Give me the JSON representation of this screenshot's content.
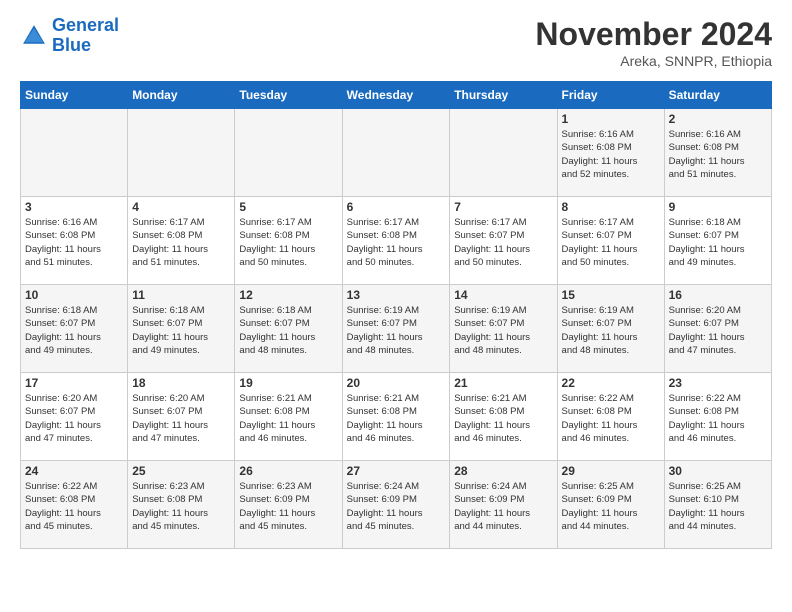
{
  "header": {
    "logo_line1": "General",
    "logo_line2": "Blue",
    "month": "November 2024",
    "location": "Areka, SNNPR, Ethiopia"
  },
  "weekdays": [
    "Sunday",
    "Monday",
    "Tuesday",
    "Wednesday",
    "Thursday",
    "Friday",
    "Saturday"
  ],
  "weeks": [
    [
      {
        "day": "",
        "info": ""
      },
      {
        "day": "",
        "info": ""
      },
      {
        "day": "",
        "info": ""
      },
      {
        "day": "",
        "info": ""
      },
      {
        "day": "",
        "info": ""
      },
      {
        "day": "1",
        "info": "Sunrise: 6:16 AM\nSunset: 6:08 PM\nDaylight: 11 hours\nand 52 minutes."
      },
      {
        "day": "2",
        "info": "Sunrise: 6:16 AM\nSunset: 6:08 PM\nDaylight: 11 hours\nand 51 minutes."
      }
    ],
    [
      {
        "day": "3",
        "info": "Sunrise: 6:16 AM\nSunset: 6:08 PM\nDaylight: 11 hours\nand 51 minutes."
      },
      {
        "day": "4",
        "info": "Sunrise: 6:17 AM\nSunset: 6:08 PM\nDaylight: 11 hours\nand 51 minutes."
      },
      {
        "day": "5",
        "info": "Sunrise: 6:17 AM\nSunset: 6:08 PM\nDaylight: 11 hours\nand 50 minutes."
      },
      {
        "day": "6",
        "info": "Sunrise: 6:17 AM\nSunset: 6:08 PM\nDaylight: 11 hours\nand 50 minutes."
      },
      {
        "day": "7",
        "info": "Sunrise: 6:17 AM\nSunset: 6:07 PM\nDaylight: 11 hours\nand 50 minutes."
      },
      {
        "day": "8",
        "info": "Sunrise: 6:17 AM\nSunset: 6:07 PM\nDaylight: 11 hours\nand 50 minutes."
      },
      {
        "day": "9",
        "info": "Sunrise: 6:18 AM\nSunset: 6:07 PM\nDaylight: 11 hours\nand 49 minutes."
      }
    ],
    [
      {
        "day": "10",
        "info": "Sunrise: 6:18 AM\nSunset: 6:07 PM\nDaylight: 11 hours\nand 49 minutes."
      },
      {
        "day": "11",
        "info": "Sunrise: 6:18 AM\nSunset: 6:07 PM\nDaylight: 11 hours\nand 49 minutes."
      },
      {
        "day": "12",
        "info": "Sunrise: 6:18 AM\nSunset: 6:07 PM\nDaylight: 11 hours\nand 48 minutes."
      },
      {
        "day": "13",
        "info": "Sunrise: 6:19 AM\nSunset: 6:07 PM\nDaylight: 11 hours\nand 48 minutes."
      },
      {
        "day": "14",
        "info": "Sunrise: 6:19 AM\nSunset: 6:07 PM\nDaylight: 11 hours\nand 48 minutes."
      },
      {
        "day": "15",
        "info": "Sunrise: 6:19 AM\nSunset: 6:07 PM\nDaylight: 11 hours\nand 48 minutes."
      },
      {
        "day": "16",
        "info": "Sunrise: 6:20 AM\nSunset: 6:07 PM\nDaylight: 11 hours\nand 47 minutes."
      }
    ],
    [
      {
        "day": "17",
        "info": "Sunrise: 6:20 AM\nSunset: 6:07 PM\nDaylight: 11 hours\nand 47 minutes."
      },
      {
        "day": "18",
        "info": "Sunrise: 6:20 AM\nSunset: 6:07 PM\nDaylight: 11 hours\nand 47 minutes."
      },
      {
        "day": "19",
        "info": "Sunrise: 6:21 AM\nSunset: 6:08 PM\nDaylight: 11 hours\nand 46 minutes."
      },
      {
        "day": "20",
        "info": "Sunrise: 6:21 AM\nSunset: 6:08 PM\nDaylight: 11 hours\nand 46 minutes."
      },
      {
        "day": "21",
        "info": "Sunrise: 6:21 AM\nSunset: 6:08 PM\nDaylight: 11 hours\nand 46 minutes."
      },
      {
        "day": "22",
        "info": "Sunrise: 6:22 AM\nSunset: 6:08 PM\nDaylight: 11 hours\nand 46 minutes."
      },
      {
        "day": "23",
        "info": "Sunrise: 6:22 AM\nSunset: 6:08 PM\nDaylight: 11 hours\nand 46 minutes."
      }
    ],
    [
      {
        "day": "24",
        "info": "Sunrise: 6:22 AM\nSunset: 6:08 PM\nDaylight: 11 hours\nand 45 minutes."
      },
      {
        "day": "25",
        "info": "Sunrise: 6:23 AM\nSunset: 6:08 PM\nDaylight: 11 hours\nand 45 minutes."
      },
      {
        "day": "26",
        "info": "Sunrise: 6:23 AM\nSunset: 6:09 PM\nDaylight: 11 hours\nand 45 minutes."
      },
      {
        "day": "27",
        "info": "Sunrise: 6:24 AM\nSunset: 6:09 PM\nDaylight: 11 hours\nand 45 minutes."
      },
      {
        "day": "28",
        "info": "Sunrise: 6:24 AM\nSunset: 6:09 PM\nDaylight: 11 hours\nand 44 minutes."
      },
      {
        "day": "29",
        "info": "Sunrise: 6:25 AM\nSunset: 6:09 PM\nDaylight: 11 hours\nand 44 minutes."
      },
      {
        "day": "30",
        "info": "Sunrise: 6:25 AM\nSunset: 6:10 PM\nDaylight: 11 hours\nand 44 minutes."
      }
    ]
  ]
}
